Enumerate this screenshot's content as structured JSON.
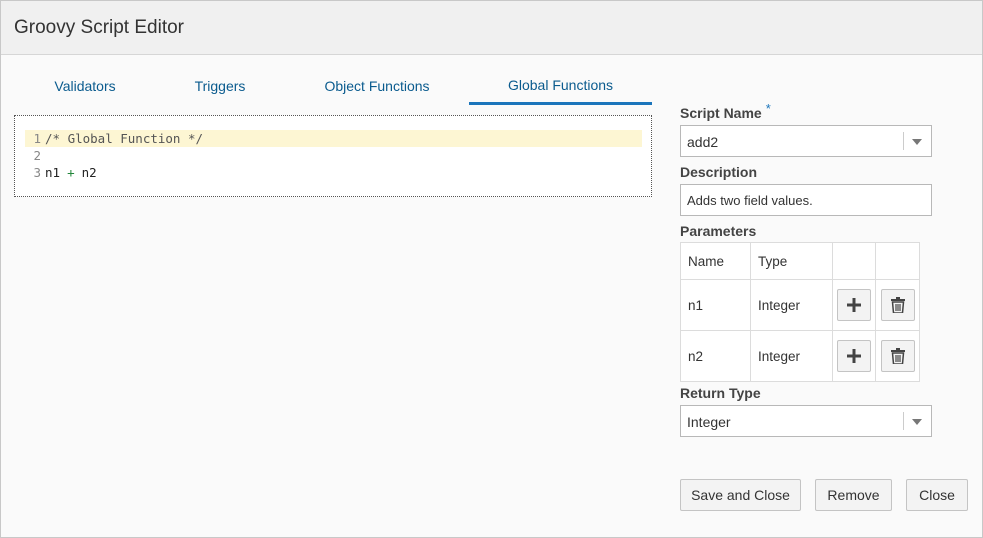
{
  "dialog": {
    "title": "Groovy Script Editor"
  },
  "tabs": [
    {
      "label": "Validators",
      "active": false
    },
    {
      "label": "Triggers",
      "active": false
    },
    {
      "label": "Object Functions",
      "active": false
    },
    {
      "label": "Global Functions",
      "active": true
    }
  ],
  "editor": {
    "lines": [
      {
        "num": "1",
        "text": "/* Global Function */"
      },
      {
        "num": "2",
        "text": ""
      },
      {
        "num": "3",
        "left": "n1",
        "op": "+",
        "right": "n2"
      }
    ]
  },
  "form": {
    "script_name_label": "Script Name",
    "required_mark": "*",
    "script_name_value": "add2",
    "description_label": "Description",
    "description_value": "Adds two field values.",
    "parameters_label": "Parameters",
    "param_headers": {
      "name": "Name",
      "type": "Type"
    },
    "params": [
      {
        "name": "n1",
        "type": "Integer"
      },
      {
        "name": "n2",
        "type": "Integer"
      }
    ],
    "return_type_label": "Return Type",
    "return_type_value": "Integer"
  },
  "buttons": {
    "save_close": "Save and Close",
    "remove": "Remove",
    "close": "Close"
  },
  "icons": {
    "add": "plus-icon",
    "delete": "trash-icon",
    "dropdown": "chevron-down-icon"
  },
  "colors": {
    "accent": "#1b75bb",
    "tab_text": "#0a5b8e",
    "highlight_line": "#fdf6d3"
  }
}
